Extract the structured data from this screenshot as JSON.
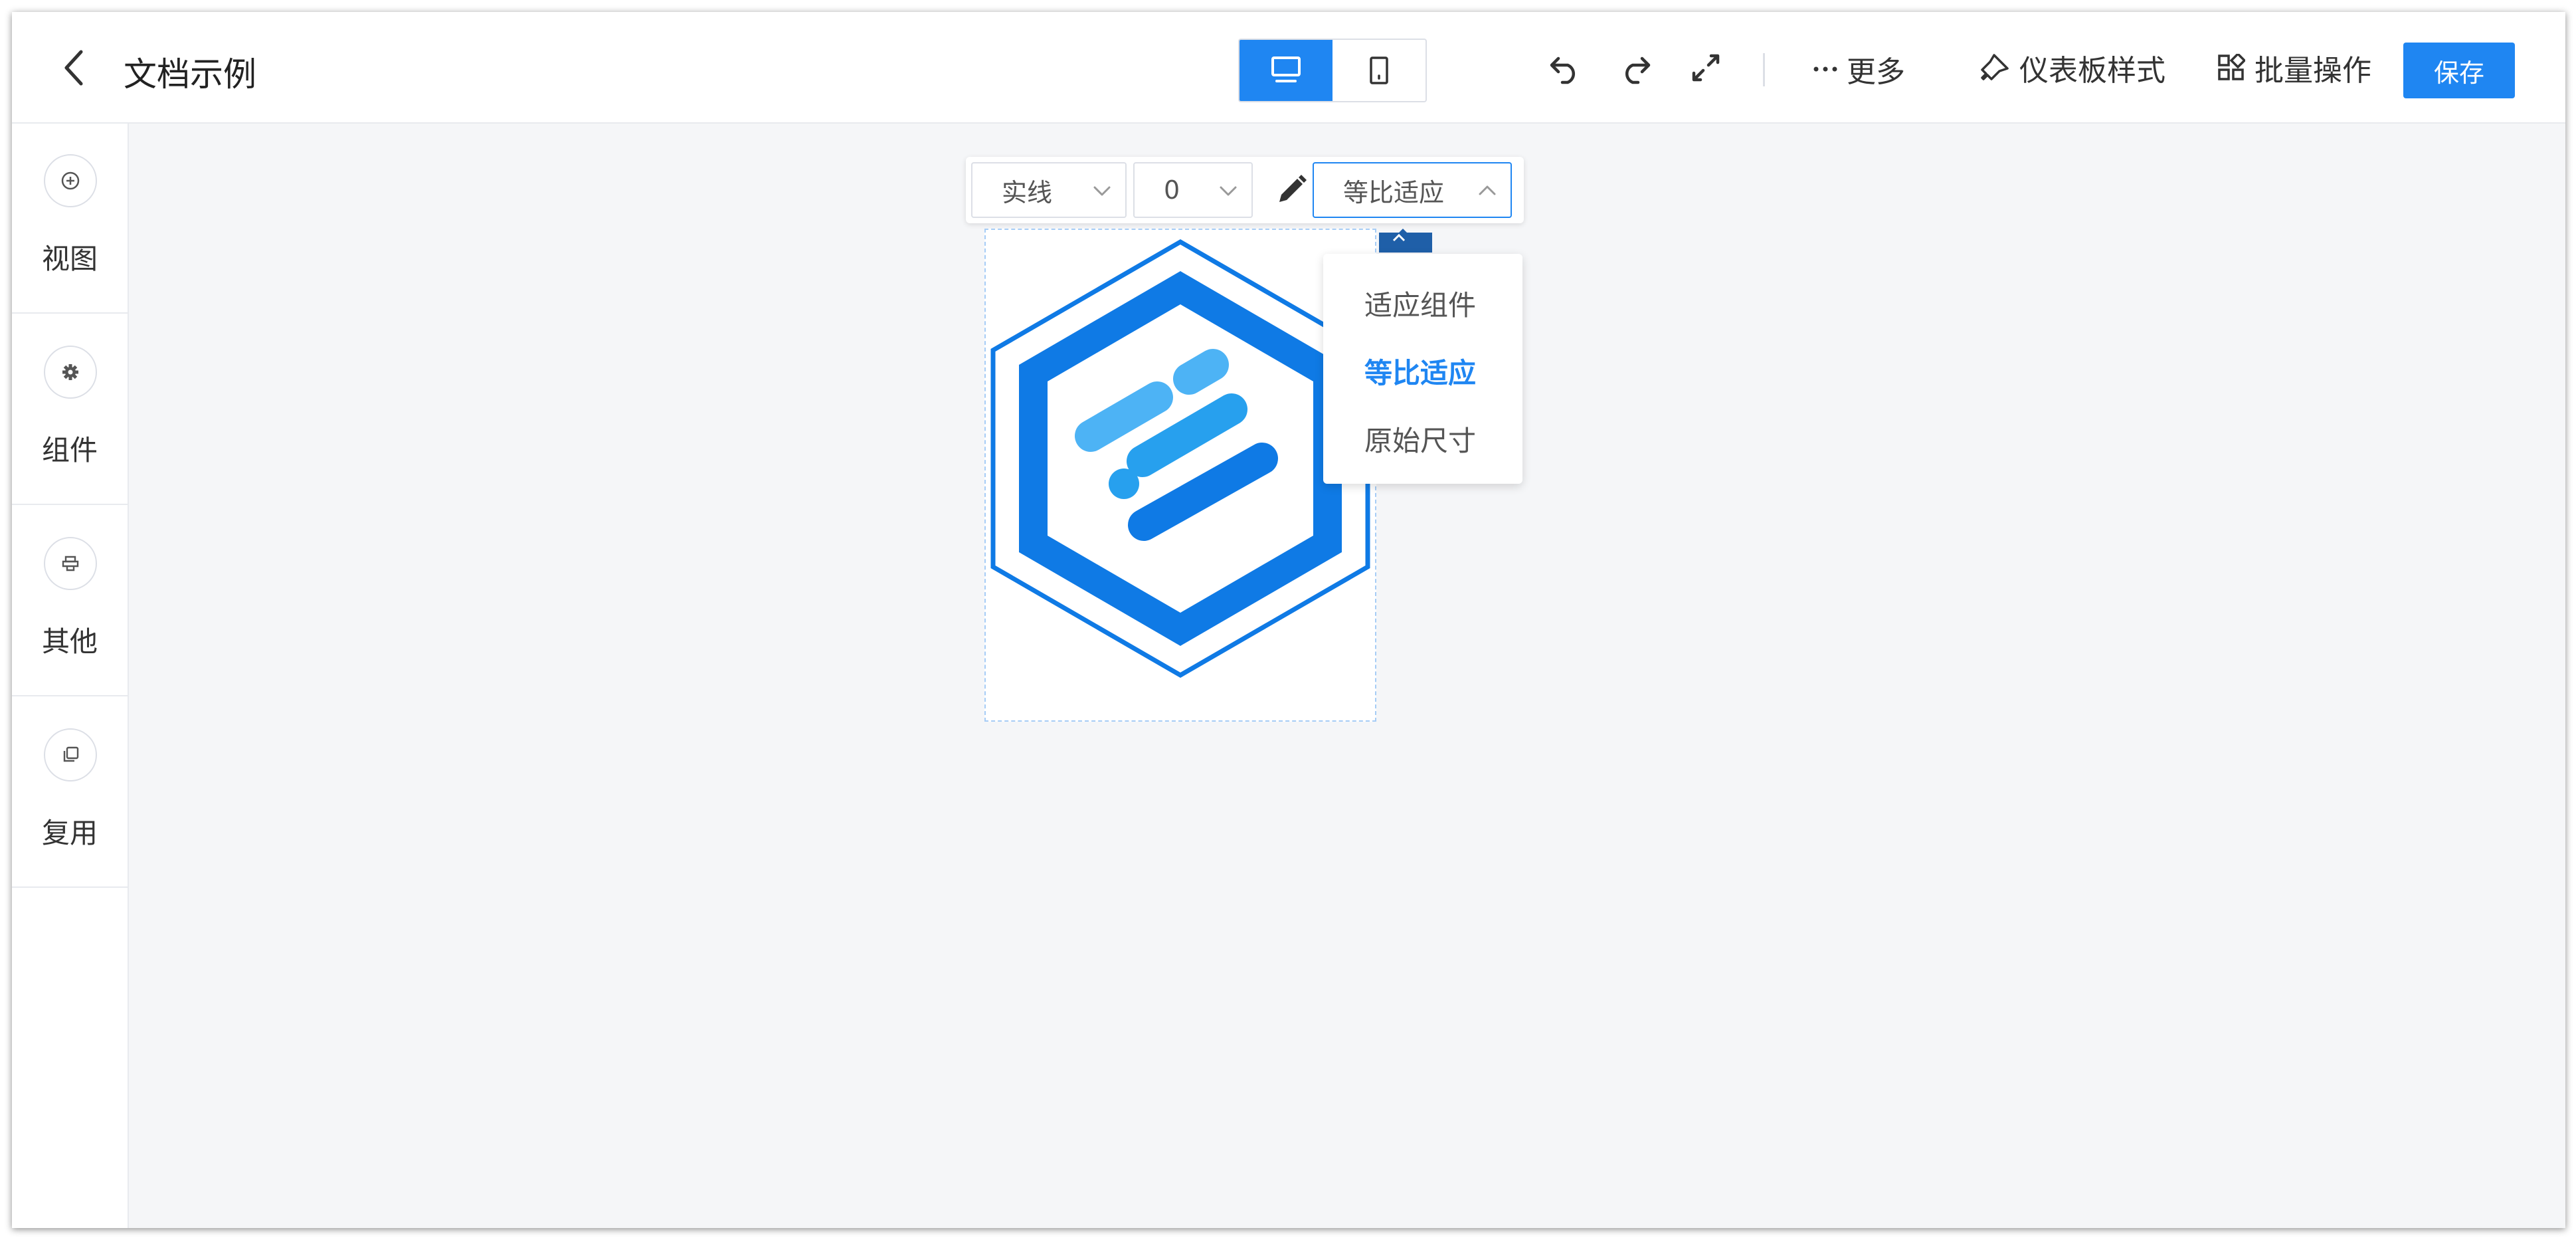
{
  "header": {
    "title": "文档示例",
    "more_label": "更多",
    "style_label": "仪表板样式",
    "batch_label": "批量操作",
    "save_label": "保存"
  },
  "view_toggle": {
    "active": "desktop"
  },
  "sidebar": {
    "items": [
      {
        "label": "视图",
        "icon": "plus-circle-icon"
      },
      {
        "label": "组件",
        "icon": "gear-icon"
      },
      {
        "label": "其他",
        "icon": "stamp-icon"
      },
      {
        "label": "复用",
        "icon": "copy-icon"
      }
    ]
  },
  "toolbar": {
    "border_style": "实线",
    "border_width": "0",
    "fit_mode": "等比适应"
  },
  "fit_dropdown": {
    "options": [
      "适应组件",
      "等比适应",
      "原始尺寸"
    ],
    "selected": "等比适应"
  },
  "colors": {
    "accent": "#1f86f2",
    "logo_dark": "#0f7ae5",
    "logo_light": "#4db3f5",
    "canvas_bg": "#f5f6f8"
  }
}
